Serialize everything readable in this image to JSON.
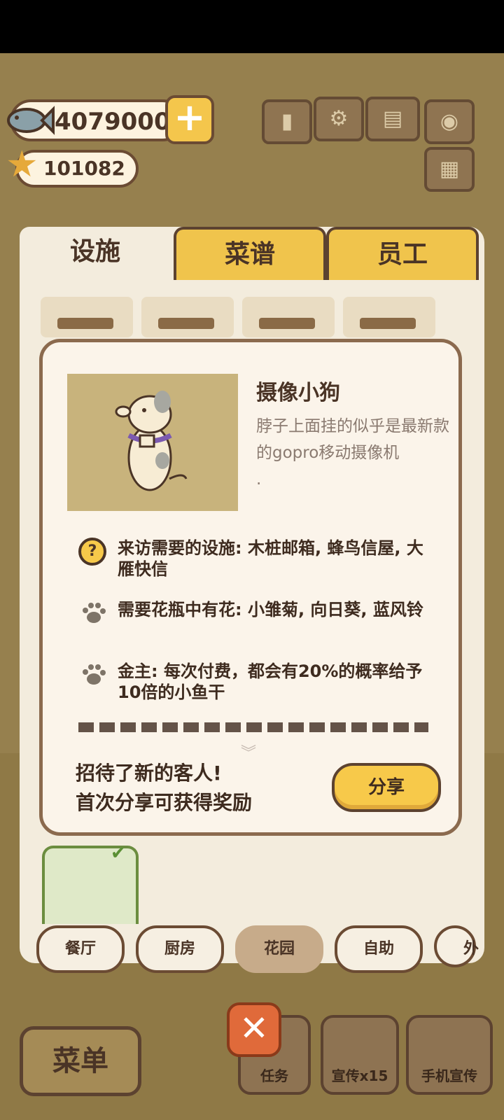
{
  "currency": {
    "fish_coins": "4079000",
    "stars": "101082"
  },
  "tabs": [
    {
      "label": "设施",
      "active": true
    },
    {
      "label": "菜谱",
      "active": false
    },
    {
      "label": "员工",
      "active": false
    }
  ],
  "dialog": {
    "character_name": "摄像小狗",
    "character_desc": "脖子上面挂的似乎是最新款的gopro移动摄像机",
    "character_desc_tail": ".",
    "requirements": [
      {
        "icon": "question-icon",
        "text": "来访需要的设施: 木桩邮箱, 蜂鸟信屋, 大雁快信"
      },
      {
        "icon": "paw-icon",
        "text": "需要花瓶中有花: 小雏菊, 向日葵, 蓝风铃"
      },
      {
        "icon": "paw-icon",
        "text": "金主: 每次付费，都会有20%的概率给予10倍的小鱼干"
      }
    ],
    "recruit_line1": "招待了新的客人!",
    "recruit_line2": "首次分享可获得奖励",
    "share_label": "分享"
  },
  "categories": [
    {
      "label": "餐厅",
      "selected": false
    },
    {
      "label": "厨房",
      "selected": false
    },
    {
      "label": "花园",
      "selected": true
    },
    {
      "label": "自助",
      "selected": false
    },
    {
      "label": "外",
      "selected": false
    }
  ],
  "hud": {
    "menu_label": "菜单",
    "task_label": "任务",
    "promo_label": "宣传x15",
    "phone_promo_label": "手机宣传"
  },
  "colors": {
    "accent_yellow": "#f7c94a",
    "brown_outline": "#5c4230",
    "dialog_bg": "#fbf4ea"
  }
}
